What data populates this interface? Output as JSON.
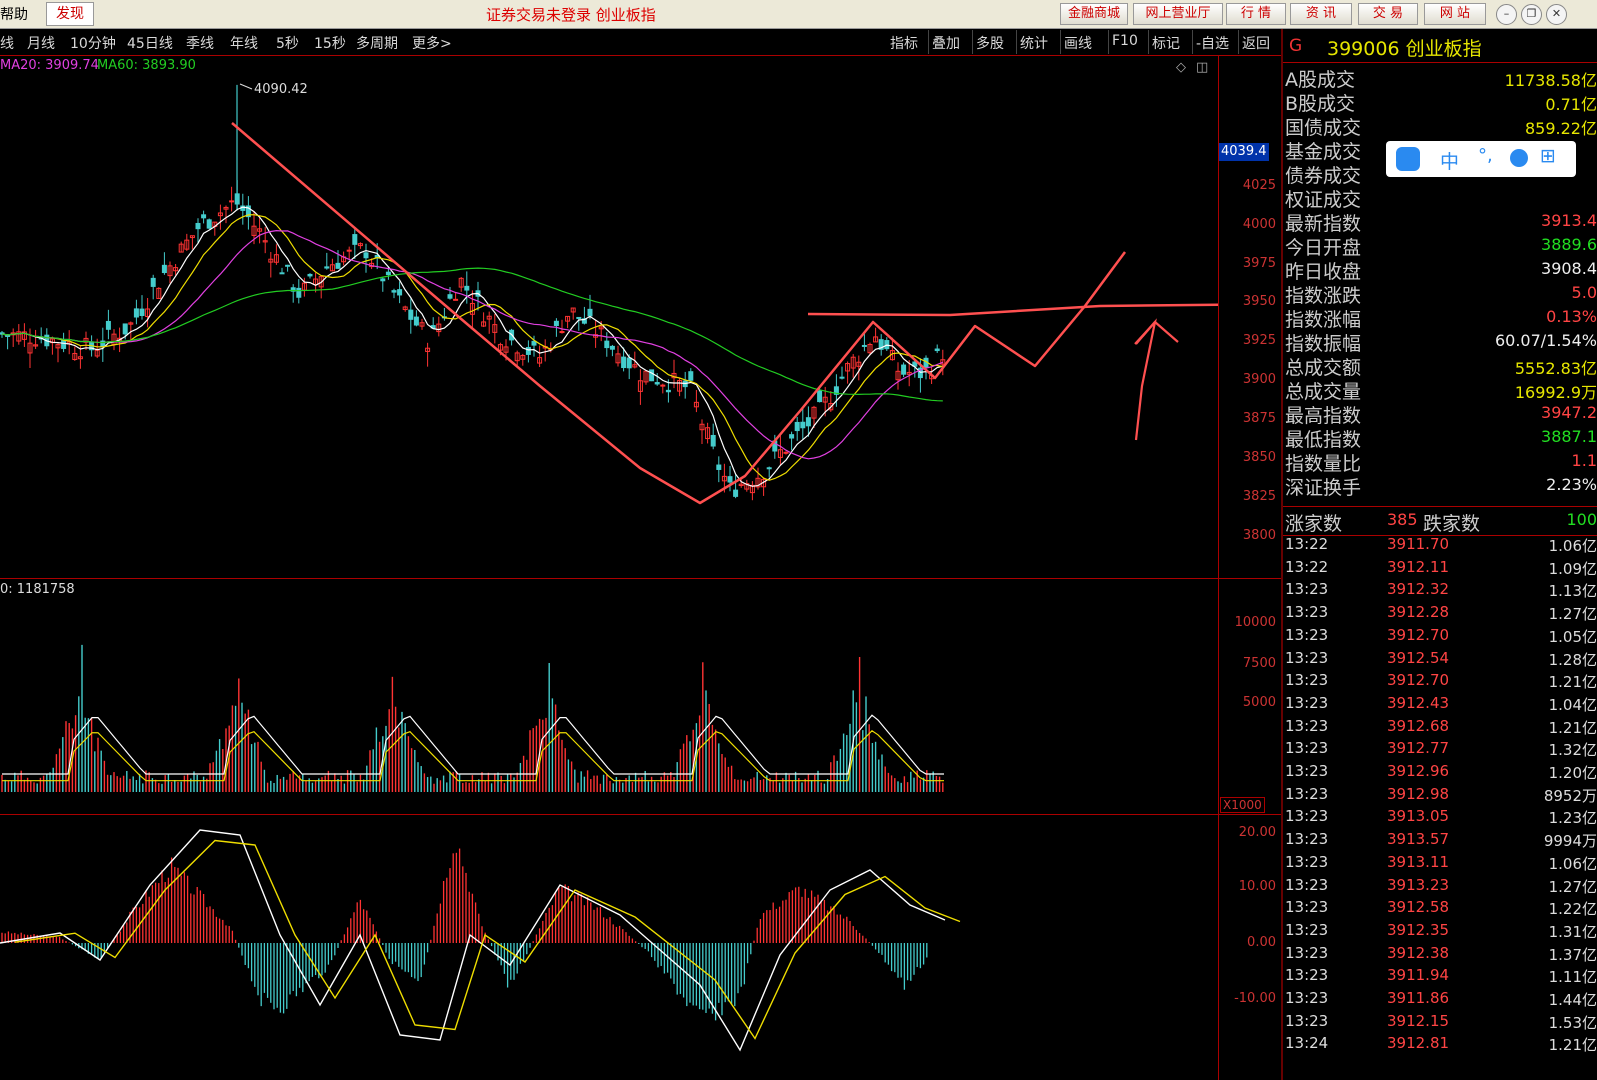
{
  "app": {
    "menu_help": "帮助",
    "tab_discover": "发现",
    "title": "证券交易未登录  创业板指",
    "buttons": [
      "金融商城",
      "网上营业厅",
      "行  情",
      "资  讯",
      "交  易",
      "网  站"
    ]
  },
  "period_bar": {
    "items": [
      "线",
      "月线",
      "10分钟",
      "45日线",
      "季线",
      "年线",
      "5秒",
      "15秒",
      "多周期",
      "更多>"
    ]
  },
  "toolbar": {
    "items": [
      "指标",
      "叠加",
      "多股",
      "统计",
      "画线",
      "F10",
      "标记",
      "-自选",
      "返回"
    ]
  },
  "ma_legend": {
    "ma20": "MA20: 3909.74",
    "ma60": "MA60: 3893.90"
  },
  "colors": {
    "ma20": "#e040e0",
    "ma60": "#22cc22",
    "up": "#ff3333",
    "down": "#44cccc",
    "axis": "#cc3333",
    "annotation": "#ff5050"
  },
  "price_chart": {
    "peak_label": "4090.42",
    "current_price": "4039.4",
    "y_ticks": [
      "4025",
      "4000",
      "3975",
      "3950",
      "3925",
      "3900",
      "3875",
      "3850",
      "3825",
      "3800"
    ]
  },
  "volume_chart": {
    "label": "0: 1181758",
    "y_ticks": [
      "10000",
      "7500",
      "5000"
    ],
    "unit": "X1000"
  },
  "macd_chart": {
    "y_ticks": [
      "20.00",
      "10.00",
      "0.00",
      "-10.00"
    ]
  },
  "quote_panel": {
    "market_flag": "G",
    "code_name": "399006 创业板指",
    "stats": [
      {
        "label": "A股成交",
        "value": "11738.58亿",
        "color": "#e6e600"
      },
      {
        "label": "B股成交",
        "value": "0.71亿",
        "color": "#e6e600"
      },
      {
        "label": "国债成交",
        "value": "859.22亿",
        "color": "#e6e600"
      },
      {
        "label": "基金成交",
        "value": "",
        "color": "#e6e600"
      },
      {
        "label": "债券成交",
        "value": "",
        "color": "#e6e600"
      },
      {
        "label": "权证成交",
        "value": "",
        "color": "#e6e600"
      },
      {
        "label": "最新指数",
        "value": "3913.4",
        "color": "#ff4444"
      },
      {
        "label": "今日开盘",
        "value": "3889.6",
        "color": "#22dd22"
      },
      {
        "label": "昨日收盘",
        "value": "3908.4",
        "color": "#eeeeee"
      },
      {
        "label": "指数涨跌",
        "value": "5.0",
        "color": "#ff4444"
      },
      {
        "label": "指数涨幅",
        "value": "0.13%",
        "color": "#ff4444"
      },
      {
        "label": "指数振幅",
        "value": "60.07/1.54%",
        "color": "#eeeeee"
      },
      {
        "label": "总成交额",
        "value": "5552.83亿",
        "color": "#e6e600"
      },
      {
        "label": "总成交量",
        "value": "16992.9万",
        "color": "#e6e600"
      },
      {
        "label": "最高指数",
        "value": "3947.2",
        "color": "#ff4444"
      },
      {
        "label": "最低指数",
        "value": "3887.1",
        "color": "#22dd22"
      },
      {
        "label": "指数量比",
        "value": "1.1",
        "color": "#ff4444"
      },
      {
        "label": "深证换手",
        "value": "2.23%",
        "color": "#eeeeee"
      }
    ],
    "up_label": "涨家数",
    "up_count": "385",
    "down_label": "跌家数",
    "down_count": "100"
  },
  "ticks": [
    {
      "time": "13:22",
      "price": "3911.70",
      "vol": "1.06亿"
    },
    {
      "time": "13:22",
      "price": "3912.11",
      "vol": "1.09亿"
    },
    {
      "time": "13:23",
      "price": "3912.32",
      "vol": "1.13亿"
    },
    {
      "time": "13:23",
      "price": "3912.28",
      "vol": "1.27亿"
    },
    {
      "time": "13:23",
      "price": "3912.70",
      "vol": "1.05亿"
    },
    {
      "time": "13:23",
      "price": "3912.54",
      "vol": "1.28亿"
    },
    {
      "time": "13:23",
      "price": "3912.70",
      "vol": "1.21亿"
    },
    {
      "time": "13:23",
      "price": "3912.43",
      "vol": "1.04亿"
    },
    {
      "time": "13:23",
      "price": "3912.68",
      "vol": "1.21亿"
    },
    {
      "time": "13:23",
      "price": "3912.77",
      "vol": "1.32亿"
    },
    {
      "time": "13:23",
      "price": "3912.96",
      "vol": "1.20亿"
    },
    {
      "time": "13:23",
      "price": "3912.98",
      "vol": "8952万"
    },
    {
      "time": "13:23",
      "price": "3913.05",
      "vol": "1.23亿"
    },
    {
      "time": "13:23",
      "price": "3913.57",
      "vol": "9994万"
    },
    {
      "time": "13:23",
      "price": "3913.11",
      "vol": "1.06亿"
    },
    {
      "time": "13:23",
      "price": "3913.23",
      "vol": "1.27亿"
    },
    {
      "time": "13:23",
      "price": "3912.58",
      "vol": "1.22亿"
    },
    {
      "time": "13:23",
      "price": "3912.35",
      "vol": "1.31亿"
    },
    {
      "time": "13:23",
      "price": "3912.38",
      "vol": "1.37亿"
    },
    {
      "time": "13:23",
      "price": "3911.94",
      "vol": "1.11亿"
    },
    {
      "time": "13:23",
      "price": "3911.86",
      "vol": "1.44亿"
    },
    {
      "time": "13:23",
      "price": "3912.15",
      "vol": "1.53亿"
    },
    {
      "time": "13:24",
      "price": "3912.81",
      "vol": "1.21亿"
    }
  ],
  "floating_badge": {
    "text": "中"
  }
}
